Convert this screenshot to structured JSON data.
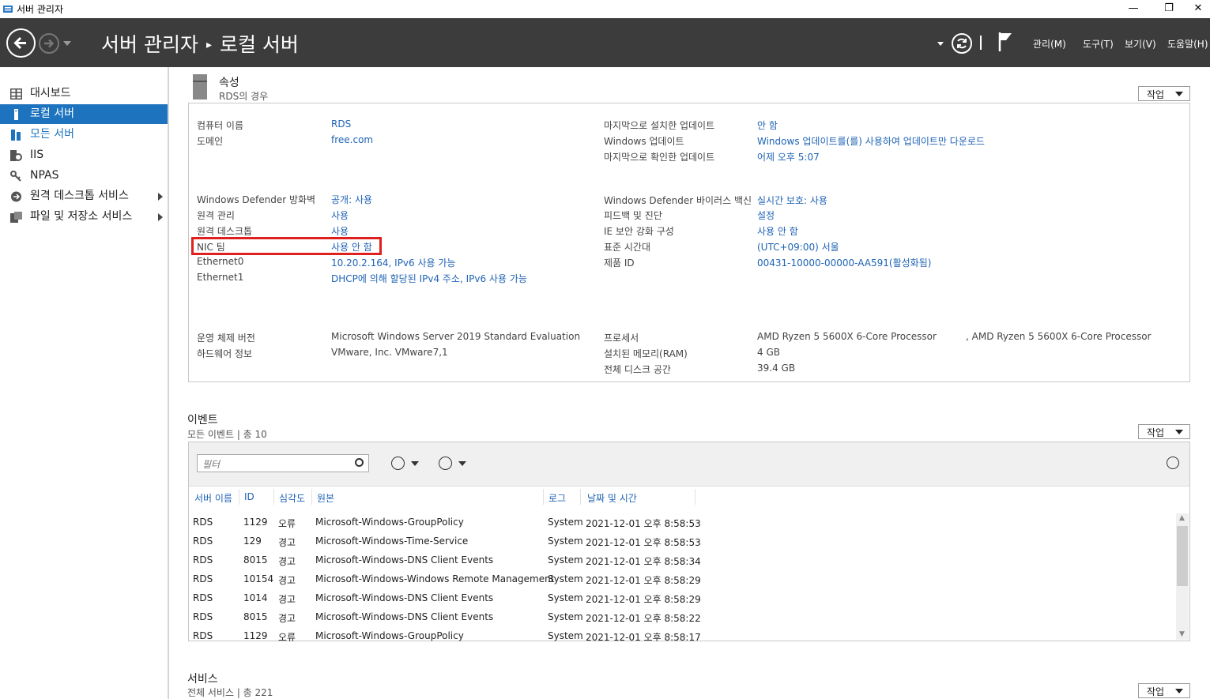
{
  "window": {
    "title": "서버 관리자",
    "minimize": "—",
    "restore": "❐",
    "close": "✕"
  },
  "header": {
    "breadcrumb_root": "서버 관리자",
    "breadcrumb_sep": "▸",
    "breadcrumb_current": "로컬 서버",
    "menus": [
      "관리(M)",
      "도구(T)",
      "보기(V)",
      "도움말(H)"
    ]
  },
  "sidebar": {
    "items": [
      {
        "label": "대시보드",
        "icon": "dashboard-icon"
      },
      {
        "label": "로컬 서버",
        "icon": "server-icon",
        "active": true
      },
      {
        "label": "모든 서버",
        "icon": "servers-icon"
      },
      {
        "label": "IIS",
        "icon": "iis-icon"
      },
      {
        "label": "NPAS",
        "icon": "npas-icon"
      },
      {
        "label": "원격 데스크톱 서비스",
        "icon": "remote-desktop-icon",
        "expandable": true
      },
      {
        "label": "파일 및 저장소 서비스",
        "icon": "file-storage-icon",
        "expandable": true
      }
    ]
  },
  "properties": {
    "title": "속성",
    "subtitle": "RDS의 경우",
    "task_label": "작업",
    "left": [
      {
        "label": "컴퓨터 이름",
        "value": "RDS"
      },
      {
        "label": "도메인",
        "value": "free.com"
      },
      {
        "label": "Windows Defender 방화벽",
        "value": "공개: 사용"
      },
      {
        "label": "원격 관리",
        "value": "사용"
      },
      {
        "label": "원격 데스크톱",
        "value": "사용"
      },
      {
        "label": "NIC 팀",
        "value": "사용 안 함"
      },
      {
        "label": "Ethernet0",
        "value": "10.20.2.164, IPv6 사용 가능"
      },
      {
        "label": "Ethernet1",
        "value": "DHCP에 의해 할당된 IPv4 주소, IPv6 사용 가능"
      },
      {
        "label": "운영 체제 버전",
        "value": "Microsoft Windows Server 2019 Standard Evaluation"
      },
      {
        "label": "하드웨어 정보",
        "value": "VMware, Inc. VMware7,1"
      }
    ],
    "right": [
      {
        "label": "마지막으로 설치한 업데이트",
        "value": "안 함"
      },
      {
        "label": "Windows 업데이트",
        "value": "Windows 업데이트를(를) 사용하여 업데이트만 다운로드"
      },
      {
        "label": "마지막으로 확인한 업데이트",
        "value": "어제 오후 5:07"
      },
      {
        "label": "Windows Defender 바이러스 백신",
        "value": "실시간 보호: 사용"
      },
      {
        "label": "피드백 및 진단",
        "value": "설정"
      },
      {
        "label": "IE 보안 강화 구성",
        "value": "사용 안 함"
      },
      {
        "label": "표준 시간대",
        "value": "(UTC+09:00) 서울"
      },
      {
        "label": "제품 ID",
        "value": "00431-10000-00000-AA591(활성화됨)"
      },
      {
        "label": "프로세서",
        "value": "AMD Ryzen 5 5600X 6-Core Processor",
        "value2": ", AMD Ryzen 5 5600X 6-Core Processor"
      },
      {
        "label": "설치된 메모리(RAM)",
        "value": "4 GB"
      },
      {
        "label": "전체 디스크 공간",
        "value": "39.4 GB"
      }
    ]
  },
  "events": {
    "title": "이벤트",
    "subtitle": "모든 이벤트 | 총 10",
    "task_label": "작업",
    "filter_placeholder": "필터",
    "columns": [
      "서버 이름",
      "ID",
      "심각도",
      "원본",
      "로그",
      "날짜 및 시간"
    ],
    "rows": [
      [
        "RDS",
        "1129",
        "오류",
        "Microsoft-Windows-GroupPolicy",
        "System",
        "2021-12-01 오후 8:58:53"
      ],
      [
        "RDS",
        "129",
        "경고",
        "Microsoft-Windows-Time-Service",
        "System",
        "2021-12-01 오후 8:58:53"
      ],
      [
        "RDS",
        "8015",
        "경고",
        "Microsoft-Windows-DNS Client Events",
        "System",
        "2021-12-01 오후 8:58:34"
      ],
      [
        "RDS",
        "10154",
        "경고",
        "Microsoft-Windows-Windows Remote Management",
        "System",
        "2021-12-01 오후 8:58:29"
      ],
      [
        "RDS",
        "1014",
        "경고",
        "Microsoft-Windows-DNS Client Events",
        "System",
        "2021-12-01 오후 8:58:29"
      ],
      [
        "RDS",
        "8015",
        "경고",
        "Microsoft-Windows-DNS Client Events",
        "System",
        "2021-12-01 오후 8:58:22"
      ],
      [
        "RDS",
        "1129",
        "오류",
        "Microsoft-Windows-GroupPolicy",
        "System",
        "2021-12-01 오후 8:58:17"
      ]
    ]
  },
  "services": {
    "title": "서비스",
    "subtitle": "전체 서비스 | 총 221",
    "task_label": "작업"
  },
  "colors": {
    "header_bg": "#3c3c3c",
    "accent": "#1e73be",
    "link": "#1f63b5",
    "highlight_border": "#e0201f"
  }
}
